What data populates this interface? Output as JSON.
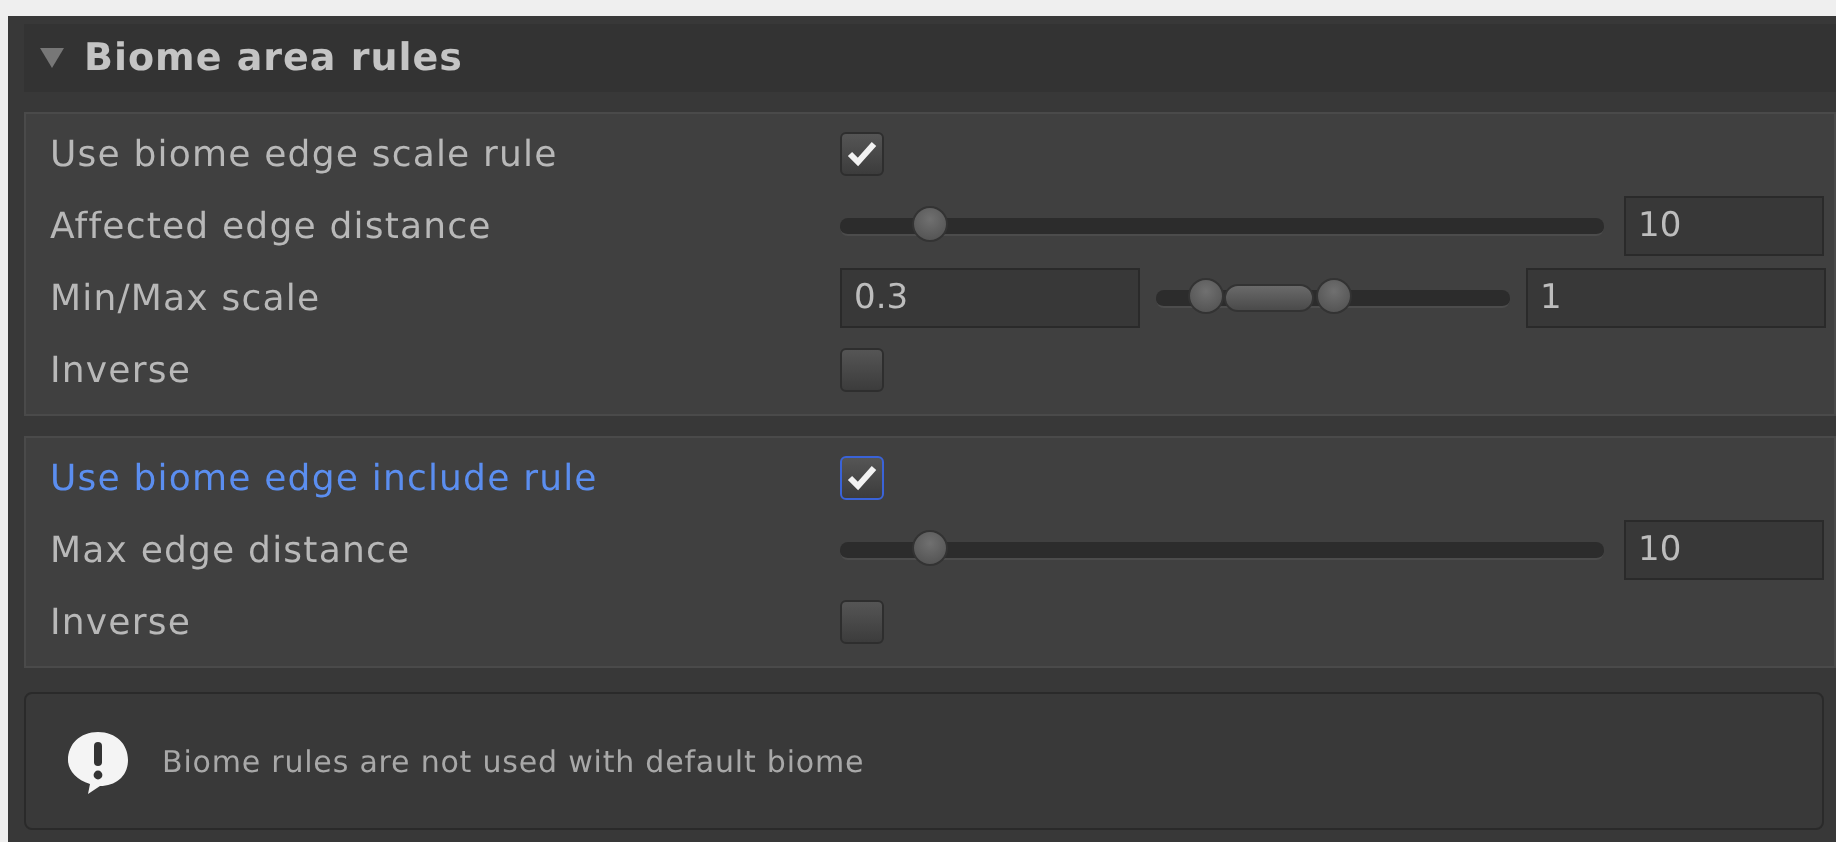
{
  "section": {
    "title": "Biome area rules",
    "expanded": true
  },
  "groups": [
    {
      "rows": [
        {
          "kind": "checkbox",
          "label": "Use biome edge scale rule",
          "checked": true,
          "focused": false
        },
        {
          "kind": "slider",
          "label": "Affected edge distance",
          "level": 0.1,
          "value": "10"
        },
        {
          "kind": "minmax",
          "label": "Min/Max scale",
          "min_value": "0.3",
          "max_value": "1",
          "min_thumb": {
            "level": 0.1
          },
          "max_thumb": {
            "level": 0.5
          }
        },
        {
          "kind": "checkbox",
          "label": "Inverse",
          "checked": false,
          "focused": false
        }
      ]
    },
    {
      "rows": [
        {
          "kind": "checkbox",
          "label": "Use biome edge include rule",
          "checked": true,
          "focused": true
        },
        {
          "kind": "slider",
          "label": "Max edge distance",
          "level": 0.1,
          "value": "10"
        },
        {
          "kind": "checkbox",
          "label": "Inverse",
          "checked": false,
          "focused": false
        }
      ]
    }
  ],
  "help_box": {
    "message": "Biome rules are not used with default biome"
  }
}
